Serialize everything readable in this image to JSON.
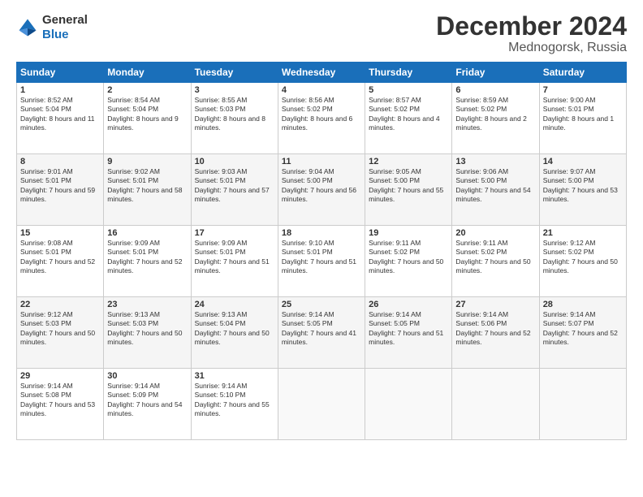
{
  "header": {
    "logo_general": "General",
    "logo_blue": "Blue",
    "month": "December 2024",
    "location": "Mednogorsk, Russia"
  },
  "days_of_week": [
    "Sunday",
    "Monday",
    "Tuesday",
    "Wednesday",
    "Thursday",
    "Friday",
    "Saturday"
  ],
  "weeks": [
    [
      {
        "day": "1",
        "rise": "Sunrise: 8:52 AM",
        "set": "Sunset: 5:04 PM",
        "daylight": "Daylight: 8 hours and 11 minutes."
      },
      {
        "day": "2",
        "rise": "Sunrise: 8:54 AM",
        "set": "Sunset: 5:04 PM",
        "daylight": "Daylight: 8 hours and 9 minutes."
      },
      {
        "day": "3",
        "rise": "Sunrise: 8:55 AM",
        "set": "Sunset: 5:03 PM",
        "daylight": "Daylight: 8 hours and 8 minutes."
      },
      {
        "day": "4",
        "rise": "Sunrise: 8:56 AM",
        "set": "Sunset: 5:02 PM",
        "daylight": "Daylight: 8 hours and 6 minutes."
      },
      {
        "day": "5",
        "rise": "Sunrise: 8:57 AM",
        "set": "Sunset: 5:02 PM",
        "daylight": "Daylight: 8 hours and 4 minutes."
      },
      {
        "day": "6",
        "rise": "Sunrise: 8:59 AM",
        "set": "Sunset: 5:02 PM",
        "daylight": "Daylight: 8 hours and 2 minutes."
      },
      {
        "day": "7",
        "rise": "Sunrise: 9:00 AM",
        "set": "Sunset: 5:01 PM",
        "daylight": "Daylight: 8 hours and 1 minute."
      }
    ],
    [
      {
        "day": "8",
        "rise": "Sunrise: 9:01 AM",
        "set": "Sunset: 5:01 PM",
        "daylight": "Daylight: 7 hours and 59 minutes."
      },
      {
        "day": "9",
        "rise": "Sunrise: 9:02 AM",
        "set": "Sunset: 5:01 PM",
        "daylight": "Daylight: 7 hours and 58 minutes."
      },
      {
        "day": "10",
        "rise": "Sunrise: 9:03 AM",
        "set": "Sunset: 5:01 PM",
        "daylight": "Daylight: 7 hours and 57 minutes."
      },
      {
        "day": "11",
        "rise": "Sunrise: 9:04 AM",
        "set": "Sunset: 5:00 PM",
        "daylight": "Daylight: 7 hours and 56 minutes."
      },
      {
        "day": "12",
        "rise": "Sunrise: 9:05 AM",
        "set": "Sunset: 5:00 PM",
        "daylight": "Daylight: 7 hours and 55 minutes."
      },
      {
        "day": "13",
        "rise": "Sunrise: 9:06 AM",
        "set": "Sunset: 5:00 PM",
        "daylight": "Daylight: 7 hours and 54 minutes."
      },
      {
        "day": "14",
        "rise": "Sunrise: 9:07 AM",
        "set": "Sunset: 5:00 PM",
        "daylight": "Daylight: 7 hours and 53 minutes."
      }
    ],
    [
      {
        "day": "15",
        "rise": "Sunrise: 9:08 AM",
        "set": "Sunset: 5:01 PM",
        "daylight": "Daylight: 7 hours and 52 minutes."
      },
      {
        "day": "16",
        "rise": "Sunrise: 9:09 AM",
        "set": "Sunset: 5:01 PM",
        "daylight": "Daylight: 7 hours and 52 minutes."
      },
      {
        "day": "17",
        "rise": "Sunrise: 9:09 AM",
        "set": "Sunset: 5:01 PM",
        "daylight": "Daylight: 7 hours and 51 minutes."
      },
      {
        "day": "18",
        "rise": "Sunrise: 9:10 AM",
        "set": "Sunset: 5:01 PM",
        "daylight": "Daylight: 7 hours and 51 minutes."
      },
      {
        "day": "19",
        "rise": "Sunrise: 9:11 AM",
        "set": "Sunset: 5:02 PM",
        "daylight": "Daylight: 7 hours and 50 minutes."
      },
      {
        "day": "20",
        "rise": "Sunrise: 9:11 AM",
        "set": "Sunset: 5:02 PM",
        "daylight": "Daylight: 7 hours and 50 minutes."
      },
      {
        "day": "21",
        "rise": "Sunrise: 9:12 AM",
        "set": "Sunset: 5:02 PM",
        "daylight": "Daylight: 7 hours and 50 minutes."
      }
    ],
    [
      {
        "day": "22",
        "rise": "Sunrise: 9:12 AM",
        "set": "Sunset: 5:03 PM",
        "daylight": "Daylight: 7 hours and 50 minutes."
      },
      {
        "day": "23",
        "rise": "Sunrise: 9:13 AM",
        "set": "Sunset: 5:03 PM",
        "daylight": "Daylight: 7 hours and 50 minutes."
      },
      {
        "day": "24",
        "rise": "Sunrise: 9:13 AM",
        "set": "Sunset: 5:04 PM",
        "daylight": "Daylight: 7 hours and 50 minutes."
      },
      {
        "day": "25",
        "rise": "Sunrise: 9:14 AM",
        "set": "Sunset: 5:05 PM",
        "daylight": "Daylight: 7 hours and 41 minutes."
      },
      {
        "day": "26",
        "rise": "Sunrise: 9:14 AM",
        "set": "Sunset: 5:05 PM",
        "daylight": "Daylight: 7 hours and 51 minutes."
      },
      {
        "day": "27",
        "rise": "Sunrise: 9:14 AM",
        "set": "Sunset: 5:06 PM",
        "daylight": "Daylight: 7 hours and 52 minutes."
      },
      {
        "day": "28",
        "rise": "Sunrise: 9:14 AM",
        "set": "Sunset: 5:07 PM",
        "daylight": "Daylight: 7 hours and 52 minutes."
      }
    ],
    [
      {
        "day": "29",
        "rise": "Sunrise: 9:14 AM",
        "set": "Sunset: 5:08 PM",
        "daylight": "Daylight: 7 hours and 53 minutes."
      },
      {
        "day": "30",
        "rise": "Sunrise: 9:14 AM",
        "set": "Sunset: 5:09 PM",
        "daylight": "Daylight: 7 hours and 54 minutes."
      },
      {
        "day": "31",
        "rise": "Sunrise: 9:14 AM",
        "set": "Sunset: 5:10 PM",
        "daylight": "Daylight: 7 hours and 55 minutes."
      },
      {
        "day": "",
        "rise": "",
        "set": "",
        "daylight": ""
      },
      {
        "day": "",
        "rise": "",
        "set": "",
        "daylight": ""
      },
      {
        "day": "",
        "rise": "",
        "set": "",
        "daylight": ""
      },
      {
        "day": "",
        "rise": "",
        "set": "",
        "daylight": ""
      }
    ]
  ]
}
